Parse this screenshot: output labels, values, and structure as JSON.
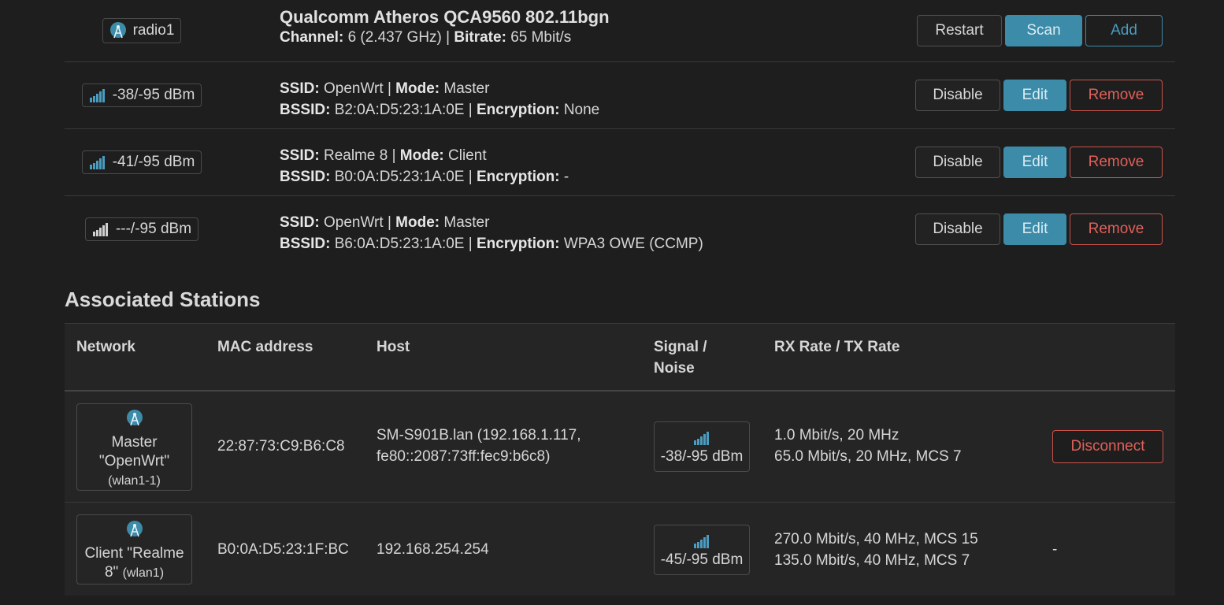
{
  "radio": {
    "badge": "radio1",
    "title": "Qualcomm Atheros QCA9560 802.11bgn",
    "channel_label": "Channel:",
    "channel_value": "6 (2.437 GHz)",
    "bitrate_label": "Bitrate:",
    "bitrate_value": "65 Mbit/s",
    "buttons": {
      "restart": "Restart",
      "scan": "Scan",
      "add": "Add"
    }
  },
  "networks": [
    {
      "signal": "-38/-95 dBm",
      "ssid": "OpenWrt",
      "mode": "Master",
      "bssid": "B2:0A:D5:23:1A:0E",
      "encryption": "None"
    },
    {
      "signal": "-41/-95 dBm",
      "ssid": "Realme 8",
      "mode": "Client",
      "bssid": "B0:0A:D5:23:1A:0E",
      "encryption": "-"
    },
    {
      "signal": "---/-95 dBm",
      "ssid": "OpenWrt",
      "mode": "Master",
      "bssid": "B6:0A:D5:23:1A:0E",
      "encryption": "WPA3 OWE (CCMP)"
    }
  ],
  "labels": {
    "ssid": "SSID:",
    "mode": "Mode:",
    "bssid": "BSSID:",
    "encryption": "Encryption:",
    "sep": "|",
    "disable": "Disable",
    "edit": "Edit",
    "remove": "Remove"
  },
  "stations": {
    "title": "Associated Stations",
    "headers": {
      "network": "Network",
      "mac": "MAC address",
      "host": "Host",
      "signal_1": "Signal /",
      "signal_2": "Noise",
      "rate": "RX Rate / TX Rate"
    },
    "rows": [
      {
        "net_1": "Master",
        "net_2": "\"OpenWrt\"",
        "net_3": "(wlan1-1)",
        "mac": "22:87:73:C9:B6:C8",
        "host_1": "SM-S901B.lan (192.168.1.117,",
        "host_2": "fe80::2087:73ff:fec9:b6c8)",
        "signal": "-38/-95 dBm",
        "rx": "1.0 Mbit/s, 20 MHz",
        "tx": "65.0 Mbit/s, 20 MHz, MCS 7",
        "action": "Disconnect"
      },
      {
        "net_1": "Client \"Realme",
        "net_2": "8\"",
        "net_3": "(wlan1)",
        "mac": "B0:0A:D5:23:1F:BC",
        "host_1": "192.168.254.254",
        "host_2": "",
        "signal": "-45/-95 dBm",
        "rx": "270.0 Mbit/s, 40 MHz, MCS 15",
        "tx": "135.0 Mbit/s, 40 MHz, MCS 7",
        "action": "-"
      }
    ]
  },
  "icons": {
    "radio": "wifi-radio-icon",
    "signal": "signal-bars-icon"
  },
  "colors": {
    "background": "#1e1e1e",
    "primary": "#3c8ba8",
    "danger": "#c9534b",
    "signal_active": "#4a9cc0",
    "signal_off": "#d0d0d0"
  }
}
